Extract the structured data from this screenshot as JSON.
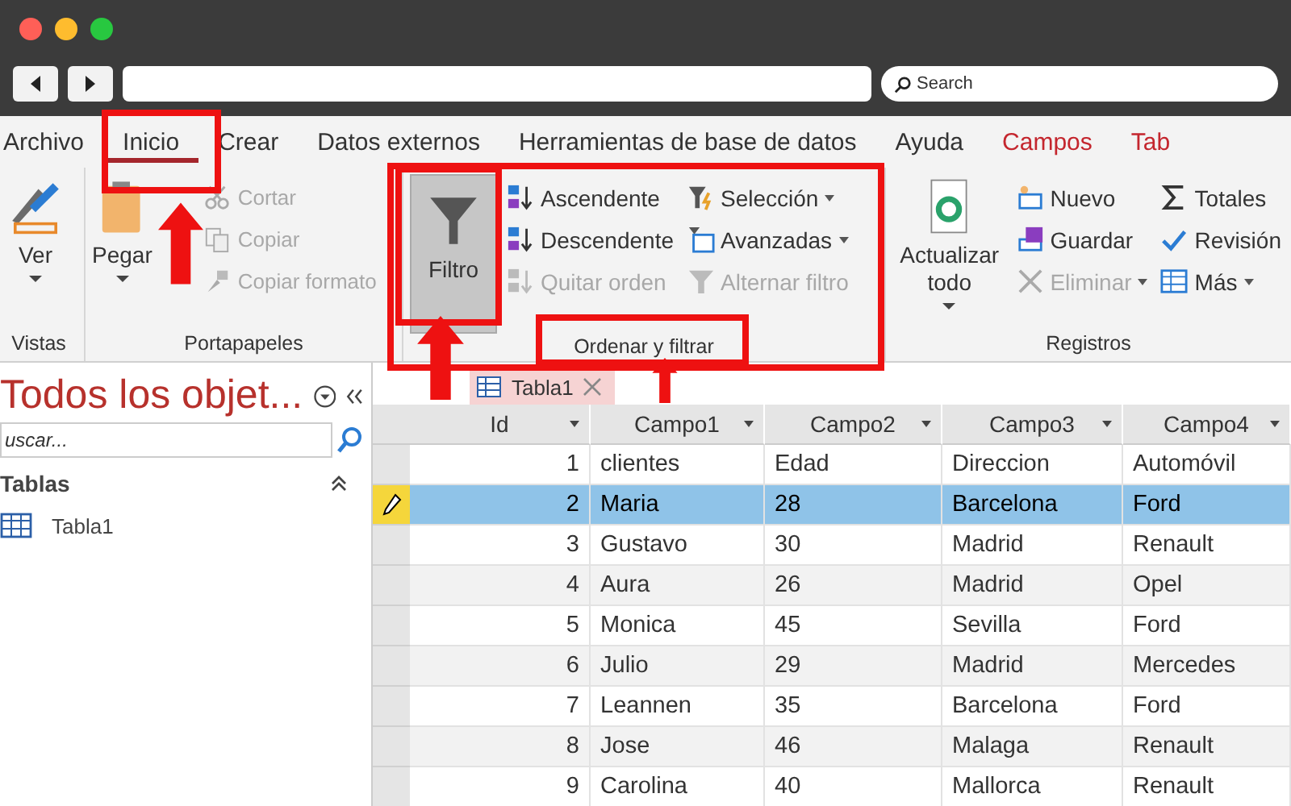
{
  "browser": {
    "search": {
      "placeholder": "Search"
    }
  },
  "ribbon": {
    "tabs": [
      {
        "label": "Archivo",
        "selected": false,
        "contextual": false
      },
      {
        "label": "Inicio",
        "selected": true,
        "contextual": false
      },
      {
        "label": "Crear",
        "selected": false,
        "contextual": false
      },
      {
        "label": "Datos externos",
        "selected": false,
        "contextual": false
      },
      {
        "label": "Herramientas de base de datos",
        "selected": false,
        "contextual": false
      },
      {
        "label": "Ayuda",
        "selected": false,
        "contextual": false
      },
      {
        "label": "Campos",
        "selected": false,
        "contextual": true
      },
      {
        "label": "Tab",
        "selected": false,
        "contextual": true
      }
    ],
    "groups": [
      {
        "label": "Vistas",
        "large": [
          {
            "label": "Ver",
            "dropdown": true,
            "selected": false
          }
        ]
      },
      {
        "label": "Portapapeles",
        "large": [
          {
            "label": "Pegar",
            "dropdown": true,
            "selected": false
          }
        ],
        "columns": [
          [
            {
              "label": "Cortar",
              "disabled": true,
              "dropdown": false
            },
            {
              "label": "Copiar",
              "disabled": true,
              "dropdown": false
            },
            {
              "label": "Copiar formato",
              "disabled": true,
              "dropdown": false
            }
          ]
        ]
      },
      {
        "label": "Ordenar y filtrar",
        "large": [
          {
            "label": "Filtro",
            "dropdown": false,
            "selected": true
          }
        ],
        "columns": [
          [
            {
              "label": "Ascendente",
              "disabled": false,
              "dropdown": false
            },
            {
              "label": "Descendente",
              "disabled": false,
              "dropdown": false
            },
            {
              "label": "Quitar orden",
              "disabled": true,
              "dropdown": false
            }
          ],
          [
            {
              "label": "Selección",
              "disabled": false,
              "dropdown": true
            },
            {
              "label": "Avanzadas",
              "disabled": false,
              "dropdown": true
            },
            {
              "label": "Alternar filtro",
              "disabled": true,
              "dropdown": false
            }
          ]
        ]
      },
      {
        "label": "Registros",
        "large": [
          {
            "label": "Actualizar todo",
            "dropdown": true,
            "selected": false
          }
        ],
        "columns": [
          [
            {
              "label": "Nuevo",
              "disabled": false,
              "dropdown": false
            },
            {
              "label": "Guardar",
              "disabled": false,
              "dropdown": false
            },
            {
              "label": "Eliminar",
              "disabled": true,
              "dropdown": true
            }
          ],
          [
            {
              "label": "Totales",
              "disabled": false,
              "dropdown": false
            },
            {
              "label": "Revisión",
              "disabled": false,
              "dropdown": false
            },
            {
              "label": "Más",
              "disabled": false,
              "dropdown": true
            }
          ]
        ]
      }
    ]
  },
  "nav_pane": {
    "title": "Todos los objet...",
    "search": {
      "placeholder": "uscar..."
    },
    "section": "Tablas",
    "items": [
      {
        "label": "Tabla1",
        "selected": false
      }
    ]
  },
  "document_tab": {
    "label": "Tabla1"
  },
  "table": {
    "columns": [
      "Id",
      "Campo1",
      "Campo2",
      "Campo3",
      "Campo4"
    ],
    "rows": [
      {
        "cells": [
          "1",
          "clientes",
          "Edad",
          "Direccion",
          "Automóvil"
        ],
        "selected": false,
        "editing": false
      },
      {
        "cells": [
          "2",
          "Maria",
          "28",
          "Barcelona",
          "Ford"
        ],
        "selected": true,
        "editing": true
      },
      {
        "cells": [
          "3",
          "Gustavo",
          "30",
          "Madrid",
          "Renault"
        ],
        "selected": false,
        "editing": false
      },
      {
        "cells": [
          "4",
          "Aura",
          "26",
          "Madrid",
          "Opel"
        ],
        "selected": false,
        "editing": false
      },
      {
        "cells": [
          "5",
          "Monica",
          "45",
          "Sevilla",
          "Ford"
        ],
        "selected": false,
        "editing": false
      },
      {
        "cells": [
          "6",
          "Julio",
          "29",
          "Madrid",
          "Mercedes"
        ],
        "selected": false,
        "editing": false
      },
      {
        "cells": [
          "7",
          "Leannen",
          "35",
          "Barcelona",
          "Ford"
        ],
        "selected": false,
        "editing": false
      },
      {
        "cells": [
          "8",
          "Jose",
          "46",
          "Malaga",
          "Renault"
        ],
        "selected": false,
        "editing": false
      },
      {
        "cells": [
          "9",
          "Carolina",
          "40",
          "Mallorca",
          "Renault"
        ],
        "selected": false,
        "editing": false
      }
    ]
  }
}
